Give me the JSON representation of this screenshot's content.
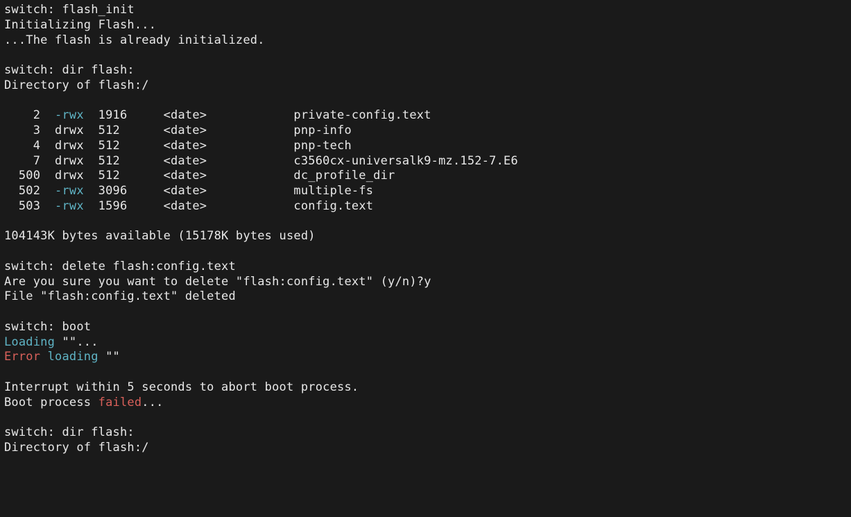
{
  "prompt": "switch:",
  "cmd_flash_init": "flash_init",
  "flash_init_out": [
    "Initializing Flash...",
    "...The flash is already initialized."
  ],
  "cmd_dir_flash": "dir flash:",
  "dir_header": "Directory of flash:/",
  "files": [
    {
      "inode": "2",
      "perm": "-rwx",
      "perm_cyan": true,
      "size": "1916",
      "date": "<date>",
      "name": "private-config.text"
    },
    {
      "inode": "3",
      "perm": "drwx",
      "perm_cyan": false,
      "size": "512",
      "date": "<date>",
      "name": "pnp-info"
    },
    {
      "inode": "4",
      "perm": "drwx",
      "perm_cyan": false,
      "size": "512",
      "date": "<date>",
      "name": "pnp-tech"
    },
    {
      "inode": "7",
      "perm": "drwx",
      "perm_cyan": false,
      "size": "512",
      "date": "<date>",
      "name": "c3560cx-universalk9-mz.152-7.E6"
    },
    {
      "inode": "500",
      "perm": "drwx",
      "perm_cyan": false,
      "size": "512",
      "date": "<date>",
      "name": "dc_profile_dir"
    },
    {
      "inode": "502",
      "perm": "-rwx",
      "perm_cyan": true,
      "size": "3096",
      "date": "<date>",
      "name": "multiple-fs"
    },
    {
      "inode": "503",
      "perm": "-rwx",
      "perm_cyan": true,
      "size": "1596",
      "date": "<date>",
      "name": "config.text"
    }
  ],
  "space_line": "104143K bytes available (15178K bytes used)",
  "cmd_delete": "delete flash:config.text",
  "delete_confirm": "Are you sure you want to delete \"flash:config.text\" (y/n)?y",
  "delete_done": "File \"flash:config.text\" deleted",
  "cmd_boot": "boot",
  "loading_word": "Loading",
  "loading_rest": " \"\"...",
  "error_word": "Error",
  "error_loading_word": "loading",
  "error_rest": " \"\"",
  "interrupt_line": "Interrupt within 5 seconds to abort boot process.",
  "boot_proc_pre": "Boot process ",
  "boot_proc_fail": "failed",
  "boot_proc_post": "...",
  "cmd_dir_flash2": "dir flash:",
  "dir_header2": "Directory of flash:/"
}
